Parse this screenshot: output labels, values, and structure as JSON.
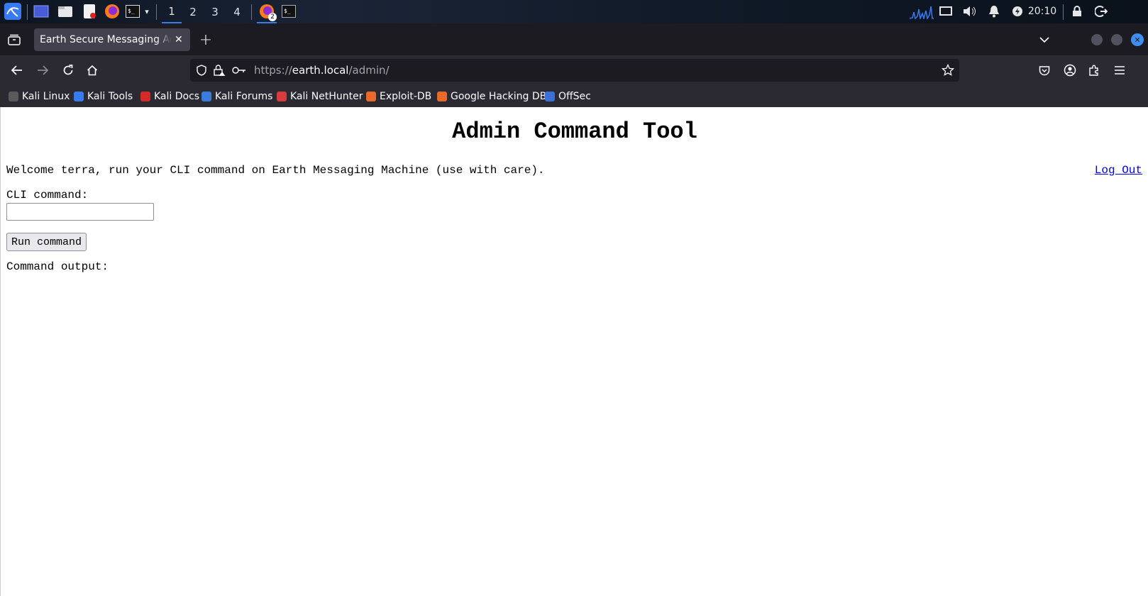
{
  "panel": {
    "workspaces": [
      "1",
      "2",
      "3",
      "4"
    ],
    "active_workspace": "1",
    "firefox_badge": "2",
    "clock": "20:10"
  },
  "browser": {
    "tab_title": "Earth Secure Messaging Admin",
    "url_prefix": "https://",
    "url_host": "earth.local",
    "url_path": "/admin/",
    "bookmarks": [
      {
        "label": "Kali Linux",
        "color": "#5a5a5a"
      },
      {
        "label": "Kali Tools",
        "color": "#367bf0"
      },
      {
        "label": "Kali Docs",
        "color": "#d42a2a"
      },
      {
        "label": "Kali Forums",
        "color": "#3b7ddd"
      },
      {
        "label": "Kali NetHunter",
        "color": "#d83b3b"
      },
      {
        "label": "Exploit-DB",
        "color": "#e86a2a"
      },
      {
        "label": "Google Hacking DB",
        "color": "#e86a2a"
      },
      {
        "label": "OffSec",
        "color": "#3d6fd8"
      }
    ]
  },
  "page": {
    "heading": "Admin Command Tool",
    "welcome": "Welcome terra, run your CLI command on Earth Messaging Machine (use with care).",
    "logout": "Log Out",
    "cli_label": "CLI command:",
    "cli_value": "",
    "run_button": "Run command",
    "output_label": "Command output:"
  }
}
